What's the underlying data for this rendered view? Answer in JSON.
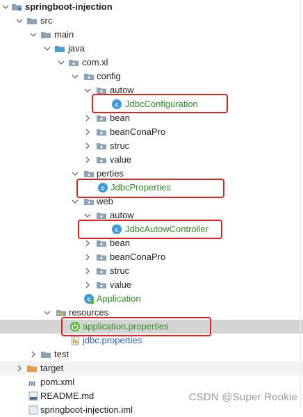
{
  "tree": {
    "rows": [
      {
        "label": "springboot-injection",
        "bold": true
      },
      {
        "label": "src"
      },
      {
        "label": "main"
      },
      {
        "label": "java"
      },
      {
        "label": "com.xl"
      },
      {
        "label": "config"
      },
      {
        "label": "autow"
      },
      {
        "label": "JdbcConfiguration"
      },
      {
        "label": "bean"
      },
      {
        "label": "beanConaPro"
      },
      {
        "label": "struc"
      },
      {
        "label": "value"
      },
      {
        "label": "perties"
      },
      {
        "label": "JdbcProperties"
      },
      {
        "label": "web"
      },
      {
        "label": "autow"
      },
      {
        "label": "JdbcAutowController"
      },
      {
        "label": "bean"
      },
      {
        "label": "beanConaPro"
      },
      {
        "label": "struc"
      },
      {
        "label": "value"
      },
      {
        "label": "Application"
      },
      {
        "label": "resources"
      },
      {
        "label": "application.properties"
      },
      {
        "label": "jdbc.properties"
      },
      {
        "label": "test"
      },
      {
        "label": "target"
      },
      {
        "label": "pom.xml"
      },
      {
        "label": "README.md"
      },
      {
        "label": "springboot-injection.iml"
      }
    ]
  },
  "colors": {
    "highlight_box": "#e0231e",
    "selected_row": "#d4d4d4",
    "folder": "#8aa3b9",
    "source_folder": "#4f9ccf",
    "class_icon": "#3d9bd9",
    "spring_icon": "#5cb531",
    "target_folder": "#e89a4a"
  },
  "watermark": "CSDN @Super Rookie"
}
